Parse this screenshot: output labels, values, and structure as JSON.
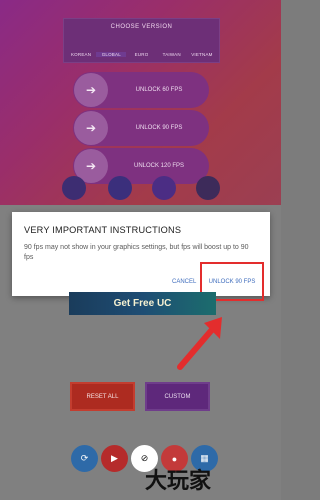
{
  "version_panel": {
    "title": "CHOOSE VERSION",
    "tabs": [
      "KOREAN",
      "GLOBAL",
      "EURO",
      "TAIWAN",
      "VIETNAM"
    ],
    "selected": "GLOBAL"
  },
  "unlock_cards": [
    {
      "label": "UNLOCK 60 FPS"
    },
    {
      "label": "UNLOCK 90 FPS"
    },
    {
      "label": "UNLOCK 120 FPS"
    }
  ],
  "dialog": {
    "title": "VERY IMPORTANT INSTRUCTIONS",
    "body": "90 fps may not show in your graphics settings, but fps will boost up to 90 fps",
    "cancel_label": "CANCEL",
    "unlock_label": "UNLOCK 90 FPS"
  },
  "banner": {
    "text": "Get Free UC"
  },
  "buttons": {
    "reset": "RESET ALL",
    "custom": "CUSTOM"
  },
  "bottom_icons": [
    "refresh-icon",
    "youtube-icon",
    "ads-block-icon",
    "app-icon",
    "grid-icon"
  ],
  "watermark": "大玩家",
  "colors": {
    "accent": "#e32d2d",
    "link": "#3f6dbd"
  }
}
